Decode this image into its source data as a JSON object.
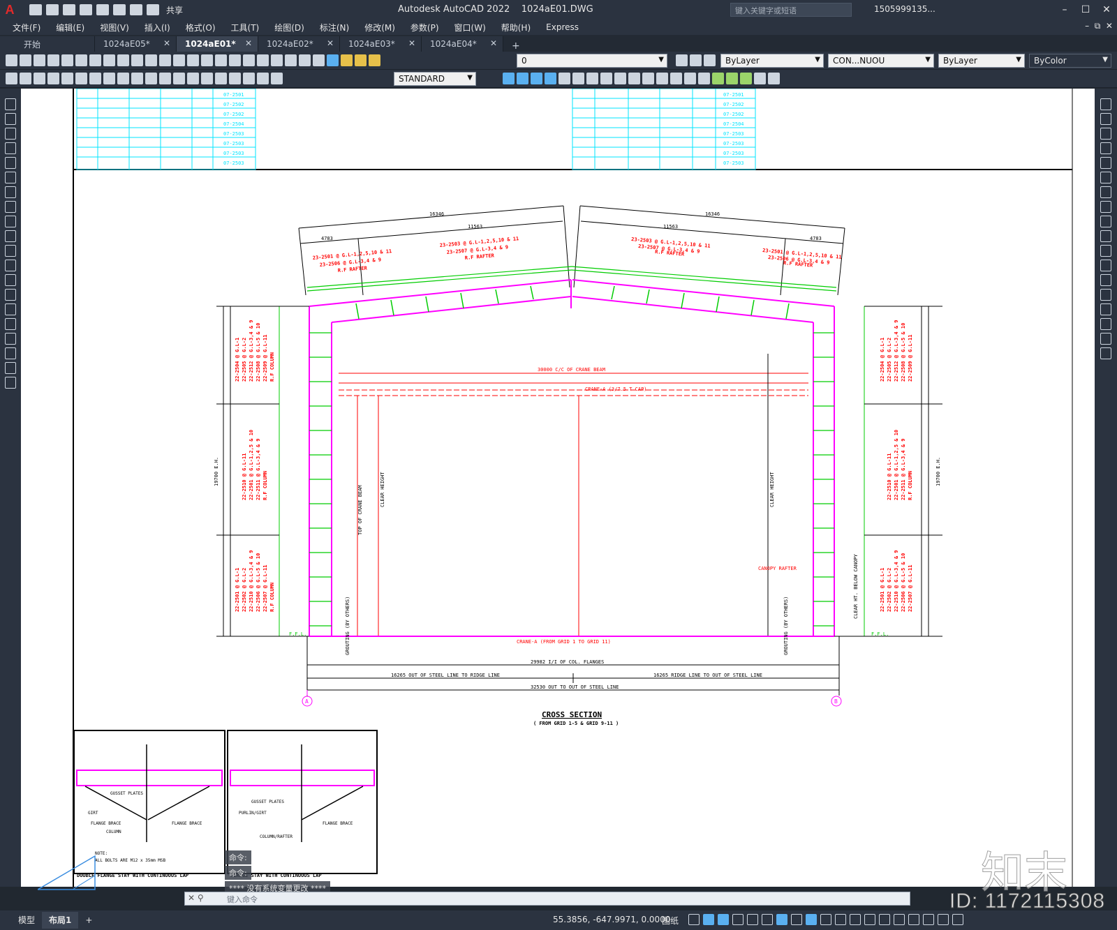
{
  "app": {
    "title": "Autodesk AutoCAD 2022",
    "filename": "1024aE01.DWG",
    "share_label": "共享",
    "search_placeholder": "键入关键字或短语",
    "user": "1505999135..."
  },
  "menu": [
    "文件(F)",
    "编辑(E)",
    "视图(V)",
    "插入(I)",
    "格式(O)",
    "工具(T)",
    "绘图(D)",
    "标注(N)",
    "修改(M)",
    "参数(P)",
    "窗口(W)",
    "帮助(H)",
    "Express"
  ],
  "tabs": [
    {
      "label": "开始",
      "active": false
    },
    {
      "label": "1024aE05*",
      "active": false
    },
    {
      "label": "1024aE01*",
      "active": true
    },
    {
      "label": "1024aE02*",
      "active": false
    },
    {
      "label": "1024aE03*",
      "active": false
    },
    {
      "label": "1024aE04*",
      "active": false
    }
  ],
  "toolbar": {
    "layer_value": "0",
    "color_value": "ByLayer",
    "linetype_value": "CON...NUOU",
    "lineweight_value": "ByLayer",
    "plotstyle_value": "ByColor",
    "textstyle_value": "STANDARD"
  },
  "drawing": {
    "dims_top": [
      "16346",
      "11563",
      "4783",
      "16346",
      "11563",
      "4783"
    ],
    "rafter_label_left_outer": [
      "23-2501 @ G.L-1,2,5,10 & 11",
      "23-2506 @ G.L-3,4 & 9",
      "R.F RAFTER"
    ],
    "rafter_label_left_inner": [
      "23-2503 @ G.L-1,2,5,10 & 11",
      "23-2507 @ G.L-3,4 & 9",
      "R.F RAFTER"
    ],
    "rafter_label_right_inner": [
      "23-2503 @ G.L-1,2,5,10 & 11",
      "23-2507 @ G.L-3,4 & 9",
      "R.F RAFTER"
    ],
    "rafter_label_right_outer": [
      "23-2501 @ G.L-1,2,5,10 & 11",
      "23-2506 @ G.L-3,4 & 9",
      "R.F RAFTER"
    ],
    "crane_beam_label": "30000 C/C OF CRANE BEAM",
    "crane_label": "CRANE-A (3/7.5 T CAP)",
    "crane_bottom_label": "CRANE-A (FROM GRID 1 TO GRID 11)",
    "dim_bottom_1": "29982 I/I OF COL. FLANGES",
    "dim_bottom_2_left": "16265 OUT OF STEEL LINE TO RIDGE LINE",
    "dim_bottom_2_right": "16265 RIDGE LINE TO OUT OF STEEL LINE",
    "dim_bottom_3": "32530 OUT TO OUT OF STEEL LINE",
    "section_title": "CROSS SECTION",
    "section_sub": "( FROM GRID 1-5 & GRID 9-11 )",
    "grid_a": "A",
    "grid_b": "B",
    "left_dim_total": "19700 E.H.",
    "right_dim_total": "19700 E.H.",
    "clear_height": "CLEAR HEIGHT",
    "top_crane_beam": "TOP OF CRANE BEAM",
    "canopy_rafter": "CANOPY RAFTER",
    "canopy_clear": "CLEAR HT. BELOW CANOPY",
    "ffl": "F.F.L.",
    "grouting": "GROUTING (BY OTHERS)",
    "col_labels_left": [
      [
        "22-2504 @ G.L-1",
        "22-2505 @ G.L-2",
        "22-2512 @ G.L-3,4 & 9",
        "22-2508 @ G.L-5 & 10",
        "22-2509 @ G.L-11",
        "R.F COLUMN"
      ],
      [
        "22-2510 @ G.L-11",
        "22-2501 @ G.L-1,2,5 & 10",
        "22-2511 @ G.L-3,4 & 9",
        "R.F COLUMN"
      ],
      [
        "22-2501 @ G.L-1",
        "22-2502 @ G.L-2",
        "22-2510 @ G.L-3,4 & 9",
        "22-2506 @ G.L-5 & 10",
        "22-2507 @ G.L-11",
        "R.F COLUMN"
      ]
    ],
    "detail_titles": [
      "DOUBLE FLANGE STAY WITH CONTINUOUS LAP",
      "FLANGE STAY WITH CONTINUOUS LAP"
    ],
    "detail_notes": [
      "GUSSET PLATES",
      "GIRT",
      "FLANGE BRACE",
      "COLUMN",
      "PURLIN/GIRT",
      "COLUMN/RAFTER",
      "NOTE:",
      "ALL BOLTS ARE M12 x 35mm MSB"
    ],
    "table_rows": [
      "07-2501",
      "07-2502",
      "07-2502",
      "07-2504",
      "07-2503",
      "07-2503",
      "07-2503",
      "07-2503"
    ]
  },
  "command": {
    "history": [
      "命令:",
      "命令:",
      "**** 没有系统变量更改 ****"
    ],
    "placeholder": "键入命令"
  },
  "status": {
    "tabs": [
      "模型",
      "布局1"
    ],
    "coords": "55.3856, -647.9971, 0.0000",
    "space": "图纸"
  },
  "watermark": {
    "logo": "知末",
    "id": "ID: 1172115308"
  },
  "colors": {
    "magenta": "#ff00ff",
    "green": "#00cc00",
    "red": "#ff0000",
    "cyan": "#00e5ff",
    "ui_dark": "#2b3340"
  }
}
